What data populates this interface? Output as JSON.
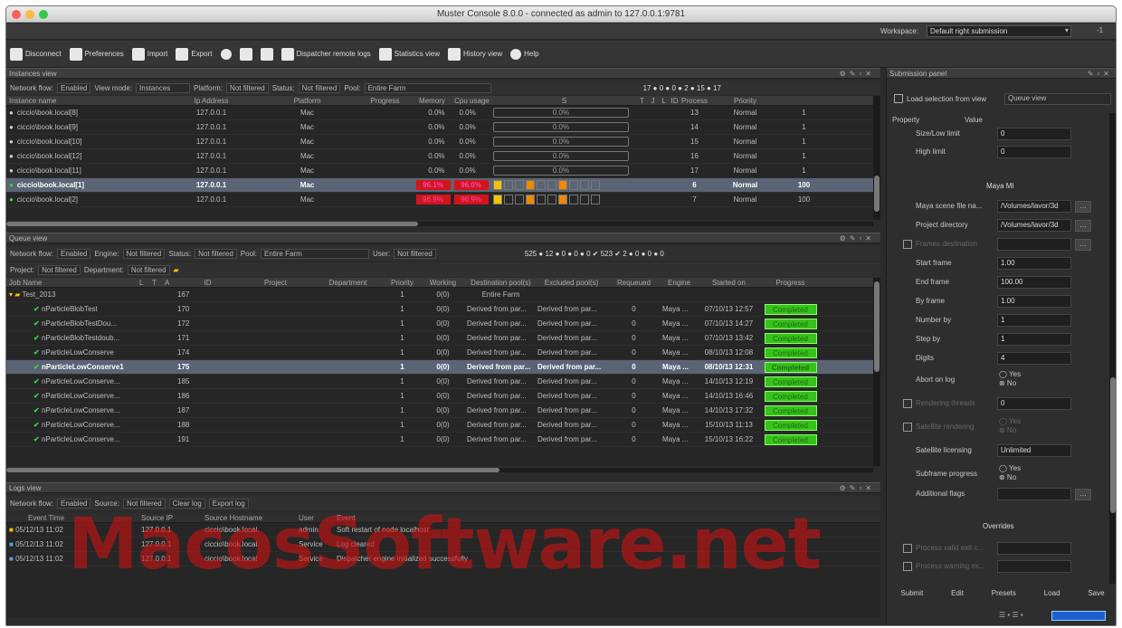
{
  "title": "Muster Console 8.0.0 - connected as admin to 127.0.0.1:9781",
  "workspace": {
    "label": "Workspace:",
    "value": "Default right submission",
    "arrow": "▾",
    "min": "-1"
  },
  "toolbar": [
    {
      "label": "Disconnect",
      "icon": "disconnect-icon"
    },
    {
      "label": "Preferences",
      "icon": "preferences-icon"
    },
    {
      "label": "Import",
      "icon": "import-icon"
    },
    {
      "label": "Export",
      "icon": "export-icon"
    },
    {
      "label": "",
      "icon": "gears-icon"
    },
    {
      "label": "",
      "icon": "render-icon"
    },
    {
      "label": "",
      "icon": "monitor-icon"
    },
    {
      "label": "Dispatcher remote logs",
      "icon": "logs-icon"
    },
    {
      "label": "Statistics view",
      "icon": "statistics-icon"
    },
    {
      "label": "History view",
      "icon": "history-icon"
    },
    {
      "label": "Help",
      "icon": "help-icon"
    }
  ],
  "instances": {
    "title": "Instances view",
    "filters": {
      "network_flow_label": "Network flow:",
      "network_flow": "Enabled",
      "view_mode_label": "View mode:",
      "view_mode": "Instances",
      "platform_label": "Platform:",
      "platform": "Not filtered",
      "status_label": "Status:",
      "status": "Not filtered",
      "pool_label": "Pool:",
      "pool": "Entire Farm"
    },
    "counters": "17 ● 0 ● 0 ● 2 ● 15 ● 17",
    "columns": [
      "Instance name",
      "",
      "Ip Address",
      "Platform",
      "Progress",
      "Memory usage",
      "Cpu usage",
      "S",
      "T",
      "J",
      "L",
      "ID",
      "Process Priority",
      "Priority"
    ],
    "rows": [
      {
        "name": "ciccio\\book.local[8]",
        "ip": "127.0.0.1",
        "platform": "Mac",
        "mem1": "0.0%",
        "mem2": "0.0%",
        "cpu": "0.0%",
        "id": "13",
        "pp": "Normal",
        "pr": "1",
        "sel": false,
        "busy": false
      },
      {
        "name": "ciccio\\book.local[9]",
        "ip": "127.0.0.1",
        "platform": "Mac",
        "mem1": "0.0%",
        "mem2": "0.0%",
        "cpu": "0.0%",
        "id": "14",
        "pp": "Normal",
        "pr": "1",
        "sel": false,
        "busy": false
      },
      {
        "name": "ciccio\\book.local[10]",
        "ip": "127.0.0.1",
        "platform": "Mac",
        "mem1": "0.0%",
        "mem2": "0.0%",
        "cpu": "0.0%",
        "id": "15",
        "pp": "Normal",
        "pr": "1",
        "sel": false,
        "busy": false
      },
      {
        "name": "ciccio\\book.local[12]",
        "ip": "127.0.0.1",
        "platform": "Mac",
        "mem1": "0.0%",
        "mem2": "0.0%",
        "cpu": "0.0%",
        "id": "16",
        "pp": "Normal",
        "pr": "1",
        "sel": false,
        "busy": false
      },
      {
        "name": "ciccio\\book.local[11]",
        "ip": "127.0.0.1",
        "platform": "Mac",
        "mem1": "0.0%",
        "mem2": "0.0%",
        "cpu": "0.0%",
        "id": "17",
        "pp": "Normal",
        "pr": "1",
        "sel": false,
        "busy": false
      },
      {
        "name": "ciccio\\book.local[1]",
        "ip": "127.0.0.1",
        "platform": "Mac",
        "mem1": "96.1%",
        "mem2": "96.0%",
        "cpu": "",
        "id": "6",
        "pp": "Normal",
        "pr": "100",
        "sel": true,
        "busy": true
      },
      {
        "name": "ciccio\\book.local[2]",
        "ip": "127.0.0.1",
        "platform": "Mac",
        "mem1": "96.9%",
        "mem2": "96.9%",
        "cpu": "",
        "id": "7",
        "pp": "Normal",
        "pr": "100",
        "sel": false,
        "busy": true
      }
    ]
  },
  "queue": {
    "title": "Queue view",
    "filters": {
      "network_flow_label": "Network flow:",
      "network_flow": "Enabled",
      "engine_label": "Engine:",
      "engine": "Not filtered",
      "status_label": "Status:",
      "status": "Not filtered",
      "pool_label": "Pool:",
      "pool": "Entire Farm",
      "user_label": "User:",
      "user": "Not filtered",
      "project_label": "Project:",
      "project": "Not filtered",
      "department_label": "Department:",
      "department": "Not filtered"
    },
    "counters": "525 ● 12 ● 0 ● 0 ● 0 ✔ 523 ✔ 2 ● 0 ● 0 ● 0",
    "columns": [
      "Job Name",
      "",
      "L",
      "T",
      "A",
      "ID",
      "Project",
      "Department",
      "Priority",
      "Working nodes",
      "Destination pool(s)",
      "Excluded pool(s)",
      "Requeued",
      "Engine",
      "Started on",
      "Progress"
    ],
    "folder": {
      "name": "Test_2013",
      "id": "167",
      "priority": "1",
      "nodes": "0(0)",
      "dest": "Entire Farm"
    },
    "rows": [
      {
        "name": "nParticleBlobTest",
        "id": "170",
        "pr": "1",
        "nodes": "0(0)",
        "dest": "Derived from par...",
        "excl": "Derived from par...",
        "req": "0",
        "engine": "Maya ...",
        "started": "07/10/13 12:57",
        "status": "Completed",
        "sel": false
      },
      {
        "name": "nParticleBlobTestDou...",
        "id": "172",
        "pr": "1",
        "nodes": "0(0)",
        "dest": "Derived from par...",
        "excl": "Derived from par...",
        "req": "0",
        "engine": "Maya ...",
        "started": "07/10/13 14:27",
        "status": "Completed",
        "sel": false
      },
      {
        "name": "nParticleBlobTestdoub...",
        "id": "171",
        "pr": "1",
        "nodes": "0(0)",
        "dest": "Derived from par...",
        "excl": "Derived from par...",
        "req": "0",
        "engine": "Maya ...",
        "started": "07/10/13 13:42",
        "status": "Completed",
        "sel": false
      },
      {
        "name": "nParticleLowConserve",
        "id": "174",
        "pr": "1",
        "nodes": "0(0)",
        "dest": "Derived from par...",
        "excl": "Derived from par...",
        "req": "0",
        "engine": "Maya ...",
        "started": "08/10/13 12:08",
        "status": "Completed",
        "sel": false
      },
      {
        "name": "nParticleLowConserve1",
        "id": "175",
        "pr": "1",
        "nodes": "0(0)",
        "dest": "Derived from par...",
        "excl": "Derived from par...",
        "req": "0",
        "engine": "Maya ...",
        "started": "08/10/13 12:31",
        "status": "Completed",
        "sel": true
      },
      {
        "name": "nParticleLowConserve...",
        "id": "185",
        "pr": "1",
        "nodes": "0(0)",
        "dest": "Derived from par...",
        "excl": "Derived from par...",
        "req": "0",
        "engine": "Maya ...",
        "started": "14/10/13 12:19",
        "status": "Completed",
        "sel": false
      },
      {
        "name": "nParticleLowConserve...",
        "id": "186",
        "pr": "1",
        "nodes": "0(0)",
        "dest": "Derived from par...",
        "excl": "Derived from par...",
        "req": "0",
        "engine": "Maya ...",
        "started": "14/10/13 16:46",
        "status": "Completed",
        "sel": false
      },
      {
        "name": "nParticleLowConserve...",
        "id": "187",
        "pr": "1",
        "nodes": "0(0)",
        "dest": "Derived from par...",
        "excl": "Derived from par...",
        "req": "0",
        "engine": "Maya ...",
        "started": "14/10/13 17:32",
        "status": "Completed",
        "sel": false
      },
      {
        "name": "nParticleLowConserve...",
        "id": "188",
        "pr": "1",
        "nodes": "0(0)",
        "dest": "Derived from par...",
        "excl": "Derived from par...",
        "req": "0",
        "engine": "Maya ...",
        "started": "15/10/13 11:13",
        "status": "Completed",
        "sel": false
      },
      {
        "name": "nParticleLowConserve...",
        "id": "191",
        "pr": "1",
        "nodes": "0(0)",
        "dest": "Derived from par...",
        "excl": "Derived from par...",
        "req": "0",
        "engine": "Maya ...",
        "started": "15/10/13 16:22",
        "status": "Completed",
        "sel": false
      }
    ]
  },
  "logs": {
    "title": "Logs view",
    "filters": {
      "network_flow_label": "Network flow:",
      "network_flow": "Enabled",
      "source_label": "Source:",
      "source": "Not filtered",
      "clear": "Clear log",
      "export": "Export log"
    },
    "columns": [
      "Event Time",
      "Source IP",
      "Source Hostname",
      "User",
      "Event"
    ],
    "rows": [
      {
        "time": "05/12/13 11:02",
        "ip": "127.0.0.1",
        "host": "ciccio\\book.local",
        "user": "admin",
        "event": "Soft restart of node localhost"
      },
      {
        "time": "05/12/13 11:02",
        "ip": "127.0.0.1",
        "host": "ciccio\\book.local",
        "user": "Service",
        "event": "Log cleared"
      },
      {
        "time": "05/12/13 11:02",
        "ip": "127.0.0.1",
        "host": "ciccio\\book.local",
        "user": "Service",
        "event": "Dispatcher engine initialized successfully"
      }
    ]
  },
  "submission": {
    "title": "Submission panel",
    "load_label": "Load selection from view",
    "view_select": "Queue view",
    "prop_header": "Property",
    "value_header": "Value",
    "top_rows": [
      {
        "k": "Size/Low limit",
        "v": "0"
      },
      {
        "k": "High limit",
        "v": "0"
      }
    ],
    "section": "Maya MI",
    "rows": [
      {
        "k": "Maya scene file na...",
        "v": "/Volumes/lavor/3d",
        "btn": true,
        "cb": false,
        "dim": false
      },
      {
        "k": "Project directory",
        "v": "/Volumes/lavor/3d",
        "btn": true,
        "cb": false,
        "dim": false
      },
      {
        "k": "Frames destination",
        "v": "",
        "btn": true,
        "cb": true,
        "dim": true
      },
      {
        "k": "Start frame",
        "v": "1.00",
        "btn": false,
        "cb": false,
        "dim": false
      },
      {
        "k": "End frame",
        "v": "100.00",
        "btn": false,
        "cb": false,
        "dim": false
      },
      {
        "k": "By frame",
        "v": "1.00",
        "btn": false,
        "cb": false,
        "dim": false
      },
      {
        "k": "Number by",
        "v": "1",
        "btn": false,
        "cb": false,
        "dim": false
      },
      {
        "k": "Step by",
        "v": "1",
        "btn": false,
        "cb": false,
        "dim": false
      },
      {
        "k": "Digits",
        "v": "4",
        "btn": false,
        "cb": false,
        "dim": false
      }
    ],
    "abort": {
      "k": "Abort on log",
      "yes": "Yes",
      "no": "No"
    },
    "rendering_threads": {
      "k": "Rendering threads",
      "v": "0"
    },
    "satellite_rendering": {
      "k": "Satellite rendering",
      "yes": "Yes",
      "no": "No"
    },
    "satellite_licensing": {
      "k": "Satellite licensing",
      "v": "Unlimited"
    },
    "subframe": {
      "k": "Subframe progress",
      "yes": "Yes",
      "no": "No"
    },
    "flags": {
      "k": "Additional flags",
      "v": ""
    },
    "overrides": "Overrides",
    "ov_rows": [
      {
        "k": "Process valid exit c..."
      },
      {
        "k": "Process warning ex..."
      }
    ],
    "buttons": [
      "Submit",
      "Edit",
      "Presets",
      "Load",
      "Save"
    ]
  },
  "watermark": "MacosSoftware.net"
}
